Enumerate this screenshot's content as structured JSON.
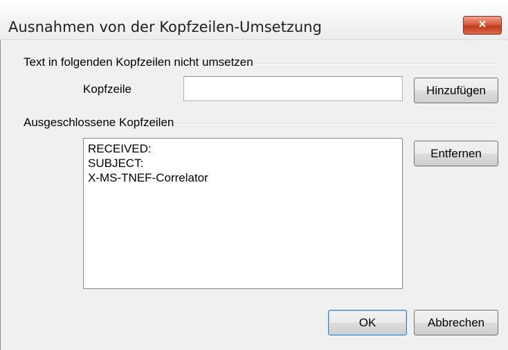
{
  "window": {
    "title": "Ausnahmen von der Kopfzeilen-Umsetzung",
    "close_label": "×"
  },
  "section_text": {
    "heading": "Text in folgenden Kopfzeilen nicht umsetzen",
    "field_label": "Kopfzeile",
    "field_value": "",
    "add_button": "Hinzufügen"
  },
  "section_excluded": {
    "heading": "Ausgeschlossene Kopfzeilen",
    "items": [
      "RECEIVED:",
      "SUBJECT:",
      "X-MS-TNEF-Correlator"
    ],
    "remove_button": "Entfernen"
  },
  "footer": {
    "ok_button": "OK",
    "cancel_button": "Abbrechen"
  }
}
